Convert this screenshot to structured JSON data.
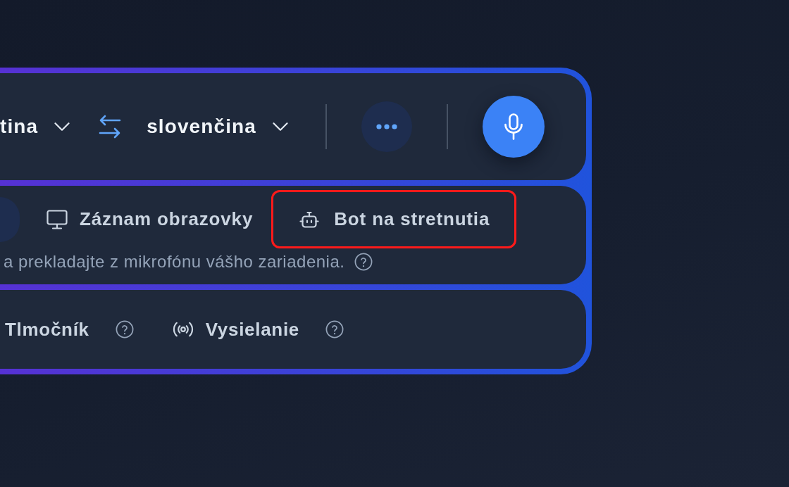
{
  "language_bar": {
    "source_language": "tina",
    "target_language": "slovenčina"
  },
  "modes": [
    {
      "selected": true,
      "highlighted": false
    },
    {
      "label": "Záznam obrazovky",
      "selected": false,
      "highlighted": false
    },
    {
      "label": "Bot na stretnutia",
      "selected": false,
      "highlighted": true
    }
  ],
  "mode_hint": "a prekladajte z mikrofónu vášho zariadenia.",
  "features": [
    {
      "label": "Tlmočník"
    },
    {
      "label": "Vysielanie"
    }
  ]
}
